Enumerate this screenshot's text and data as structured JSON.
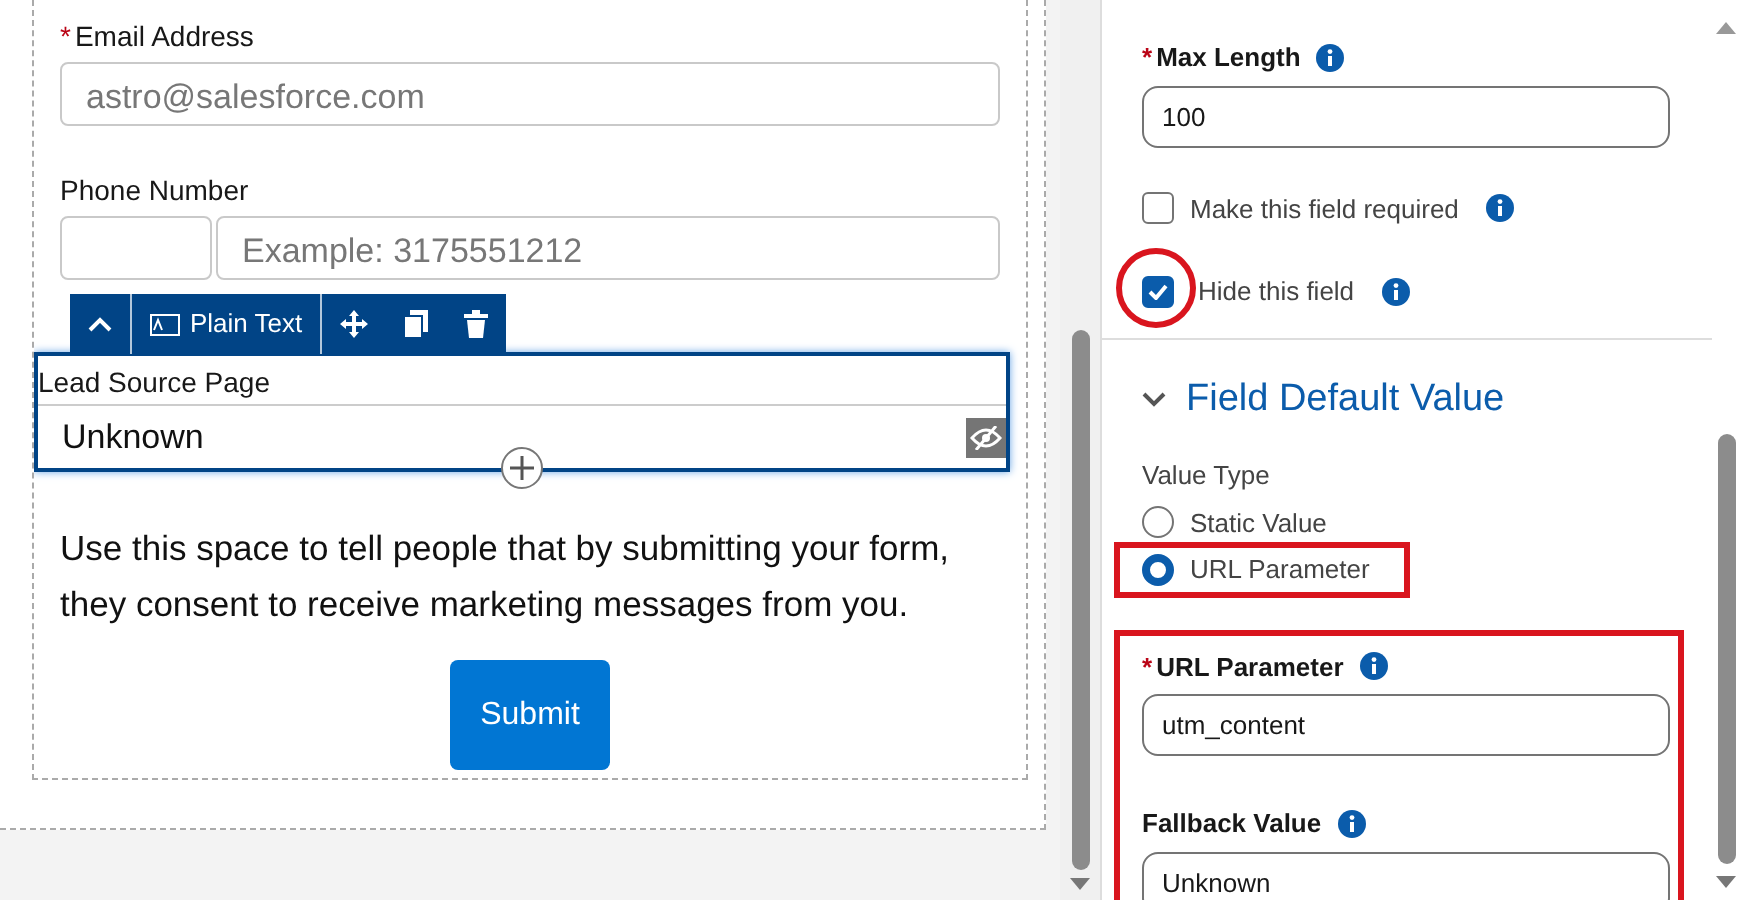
{
  "form_canvas": {
    "fields": [
      {
        "kind": "text",
        "label": "Email Address",
        "required_mark": "*",
        "placeholder": "astro@salesforce.com"
      },
      {
        "kind": "phone",
        "label": "Phone Number",
        "placeholder": "Example: 3175551212"
      }
    ],
    "selected_field": {
      "toolbar_label": "Plain Text",
      "label": "Lead Source Page",
      "value": "Unknown",
      "hidden": true
    },
    "consent_text": "Use this space to tell people that by submitting your form, they consent to receive marketing messages from you.",
    "submit_button": "Submit"
  },
  "properties_panel": {
    "max_length": {
      "label": "Max Length",
      "required_mark": "*",
      "value": "100"
    },
    "options": [
      {
        "label": "Make this field required",
        "checked": false,
        "highlighted": false
      },
      {
        "label": "Hide this field",
        "checked": true,
        "highlighted": true
      }
    ],
    "section": {
      "title": "Field Default Value",
      "expanded": true
    },
    "value_type": {
      "label": "Value Type",
      "options": [
        {
          "label": "Static Value",
          "selected": false,
          "highlighted": false
        },
        {
          "label": "URL Parameter",
          "selected": true,
          "highlighted": true
        }
      ]
    },
    "default_fields": {
      "highlighted": true,
      "fields": [
        {
          "label": "URL Parameter",
          "required_mark": "*",
          "value": "utm_content"
        },
        {
          "label": "Fallback Value",
          "value": "Unknown"
        }
      ]
    }
  }
}
